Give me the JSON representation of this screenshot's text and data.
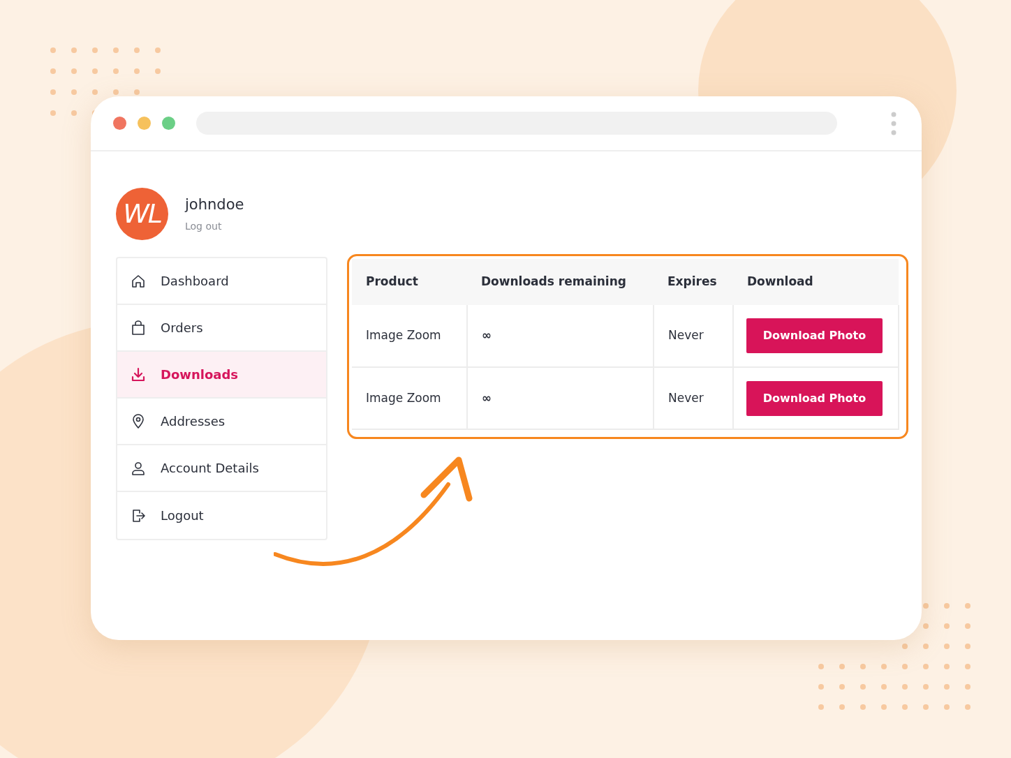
{
  "browser": {
    "window_controls": [
      {
        "color": "#f07560"
      },
      {
        "color": "#f6c15c"
      },
      {
        "color": "#6bcf86"
      }
    ]
  },
  "profile": {
    "logo": "WL",
    "username": "johndoe",
    "logout_link": "Log out"
  },
  "sidebar": {
    "items": [
      {
        "label": "Dashboard",
        "kind": "home",
        "selected": false
      },
      {
        "label": "Orders",
        "kind": "bag",
        "selected": false
      },
      {
        "label": "Downloads",
        "kind": "download",
        "selected": true
      },
      {
        "label": "Addresses",
        "kind": "pin",
        "selected": false
      },
      {
        "label": "Account Details",
        "kind": "person",
        "selected": false
      },
      {
        "label": "Logout",
        "kind": "exit",
        "selected": false
      }
    ]
  },
  "table": {
    "columns": [
      "Product",
      "Downloads remaining",
      "Expires",
      "Download"
    ],
    "rows": [
      {
        "product": "Image Zoom",
        "downloads_remaining": "∞",
        "expires": "Never",
        "download_button": "Download Photo"
      },
      {
        "product": "Image Zoom",
        "downloads_remaining": "∞",
        "expires": "Never",
        "download_button": "Download Photo"
      }
    ]
  }
}
